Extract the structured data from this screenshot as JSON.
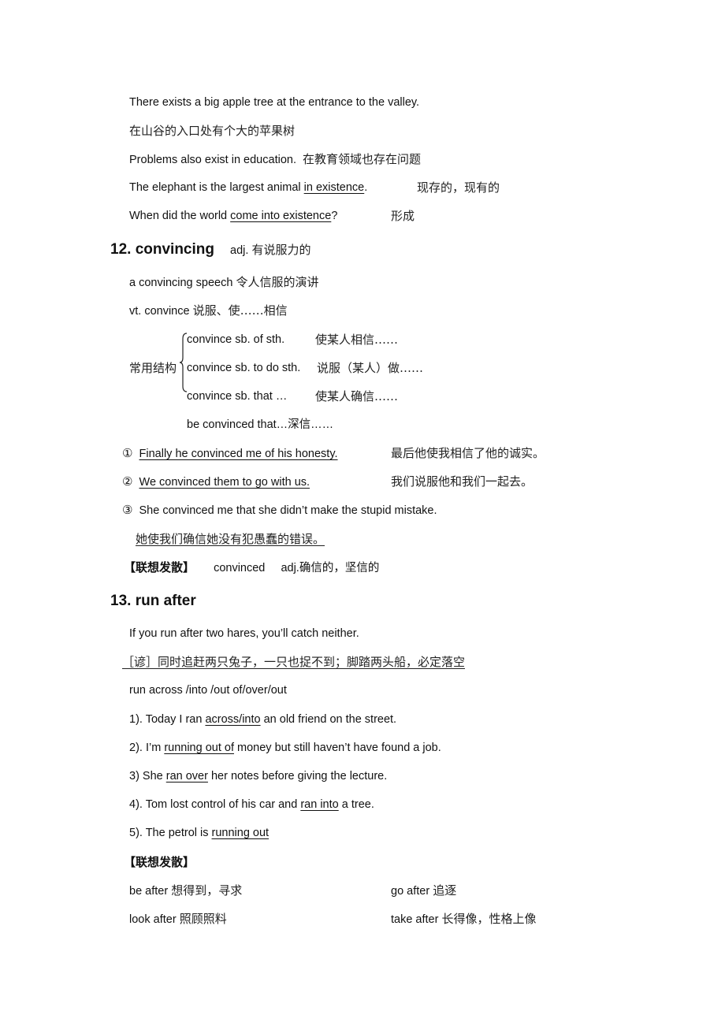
{
  "existence_examples": {
    "s1": "There exists a big apple tree at the entrance to the valley.",
    "s1_cn": "在山谷的入口处有个大的苹果树",
    "s2": "Problems also exist in education.",
    "s2_cn": "在教育领域也存在问题",
    "s3_pre": "The elephant is the largest animal ",
    "s3_u": "in existence",
    "s3_post": ".",
    "s3_cn": "现存的，现有的",
    "s4_pre": "When did the world ",
    "s4_u": "come into existence",
    "s4_post": "?",
    "s4_cn": "形成"
  },
  "section12": {
    "heading": "12. convincing",
    "pos": "adj.",
    "meaning": "有说服力的",
    "phrase": "a convincing speech",
    "phrase_cn": "令人信服的演讲",
    "verb": "vt. convince",
    "verb_cn": "说服、使……相信",
    "structures_label": "常用结构",
    "structures": [
      {
        "en": "convince sb. of sth.",
        "cn": "使某人相信……"
      },
      {
        "en": "convince sb. to do sth.",
        "cn": "说服（某人）做……"
      },
      {
        "en": "convince sb. that …",
        "cn": "使某人确信……"
      }
    ],
    "extra_structure": "be convinced that…深信……",
    "examples": [
      {
        "num": "①",
        "en": "Finally he convinced me of his honesty.",
        "cn": "最后他使我相信了他的诚实。"
      },
      {
        "num": "②",
        "en": "We convinced them to go with us.",
        "cn": "我们说服他和我们一起去。"
      },
      {
        "num": "③",
        "en": "She convinced me that she didn’t make the stupid mistake.",
        "cn": "她使我们确信她没有犯愚蠢的错误。"
      }
    ],
    "assoc_label": "【联想发散】",
    "assoc_word": "convinced",
    "assoc_meaning": "adj.确信的，坚信的"
  },
  "section13": {
    "heading": "13. run after",
    "proverb": "If you run after two hares, you’ll catch neither.",
    "proverb_cn": "［谚］同时追赶两只兔子，一只也捉不到；脚踏两头船，必定落空",
    "related": "run across /into /out of/over/out",
    "examples": [
      {
        "pre": "1). Today I ran ",
        "u": "across/into",
        "post": " an old friend on the street."
      },
      {
        "pre": "2). I’m ",
        "u": "running out of",
        "post": " money but still haven’t have found a job."
      },
      {
        "pre": "3) She ",
        "u": "ran over",
        "post": " her notes before giving the lecture."
      },
      {
        "pre": "4). Tom lost control of his car and ",
        "u": "ran into",
        "post": " a tree."
      },
      {
        "pre": "5). The petrol is ",
        "u": "running out",
        "post": ""
      }
    ],
    "assoc_label": "【联想发散】",
    "phrases": [
      {
        "en": "be after",
        "cn": "想得到，寻求"
      },
      {
        "en": "go after",
        "cn": "追逐"
      },
      {
        "en": "look after",
        "cn": "照顾照料"
      },
      {
        "en": "take after",
        "cn": "长得像，性格上像"
      }
    ]
  }
}
